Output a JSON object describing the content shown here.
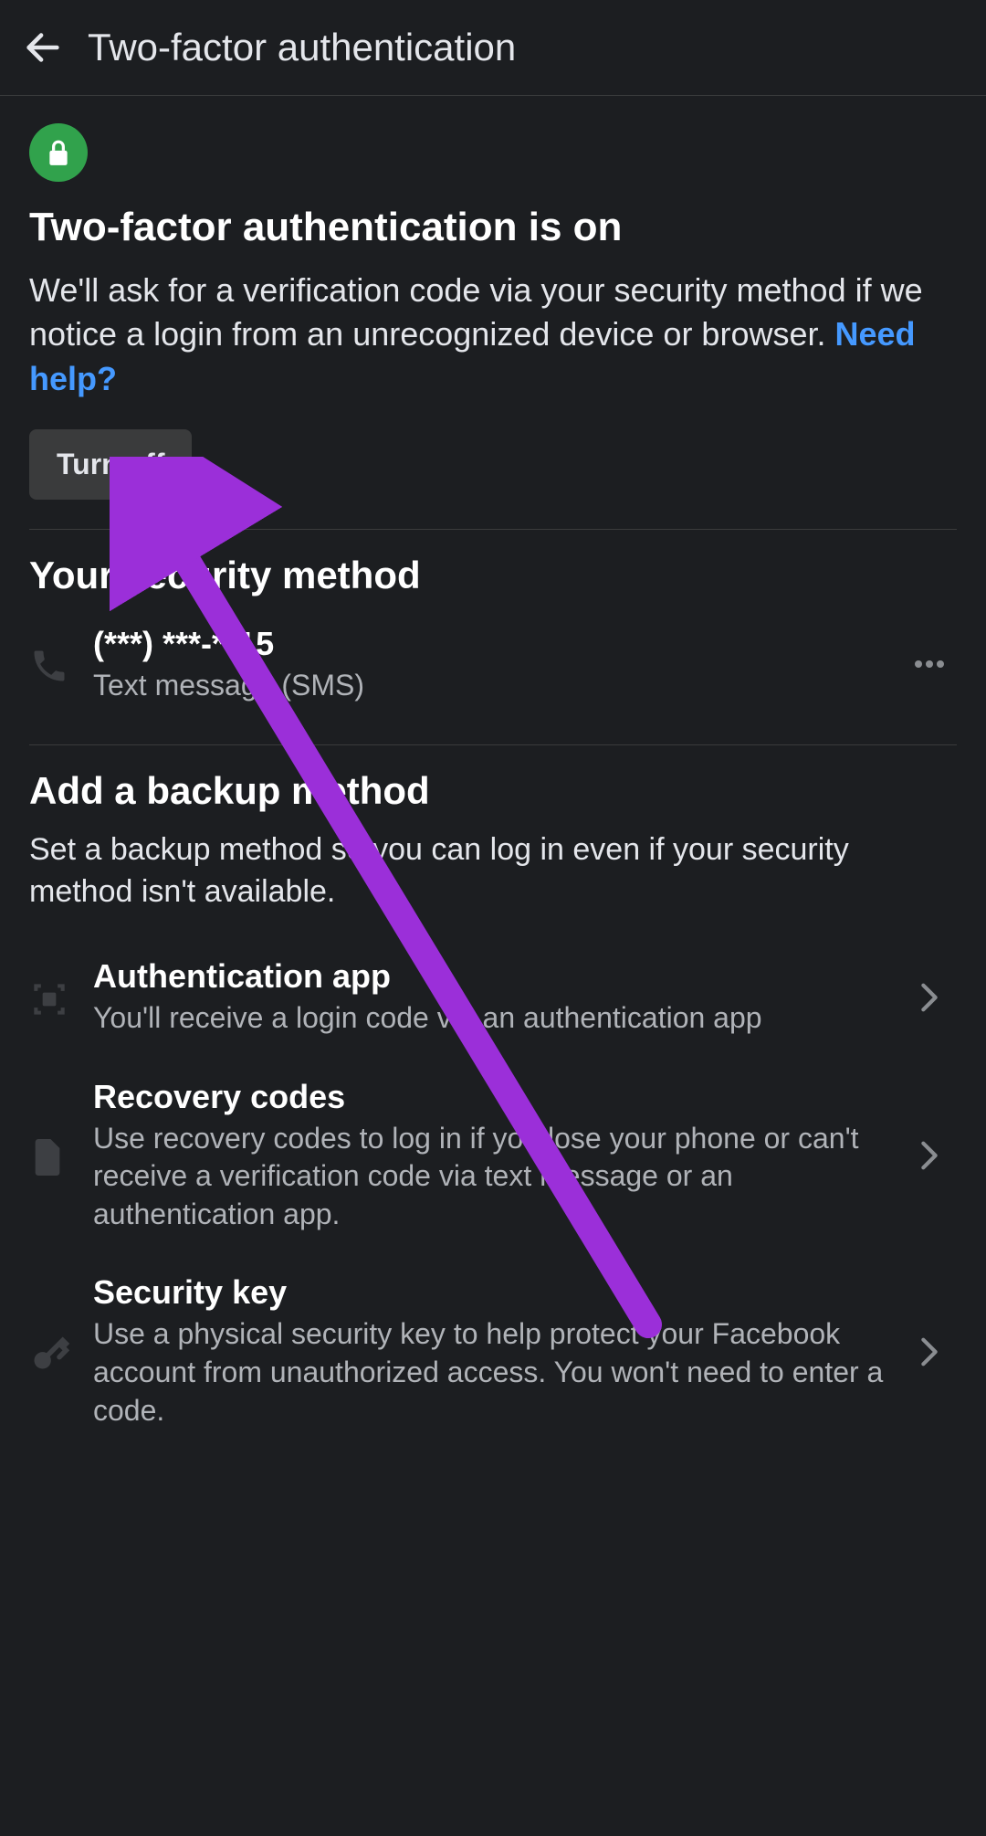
{
  "header": {
    "title": "Two-factor authentication"
  },
  "status": {
    "heading": "Two-factor authentication is on",
    "description": "We'll ask for a verification code via your security method if we notice a login from an unrecognized device or browser. ",
    "help_link": "Need help?",
    "turn_off_label": "Turn off"
  },
  "security_method": {
    "heading": "Your security method",
    "phone_masked": "(***) ***-**15",
    "type_label": "Text message (SMS)"
  },
  "backup": {
    "heading": "Add a backup method",
    "description": "Set a backup method so you can log in even if your security method isn't available.",
    "methods": [
      {
        "title": "Authentication app",
        "desc": "You'll receive a login code via an authentication app"
      },
      {
        "title": "Recovery codes",
        "desc": "Use recovery codes to log in if you lose your phone or can't receive a verification code via text message or an authentication app."
      },
      {
        "title": "Security key",
        "desc": "Use a physical security key to help protect your Facebook account from unauthorized access. You won't need to enter a code."
      }
    ]
  },
  "colors": {
    "accent_green": "#31a24c",
    "link_blue": "#4599ff",
    "annotation_purple": "#9b2fd9"
  }
}
